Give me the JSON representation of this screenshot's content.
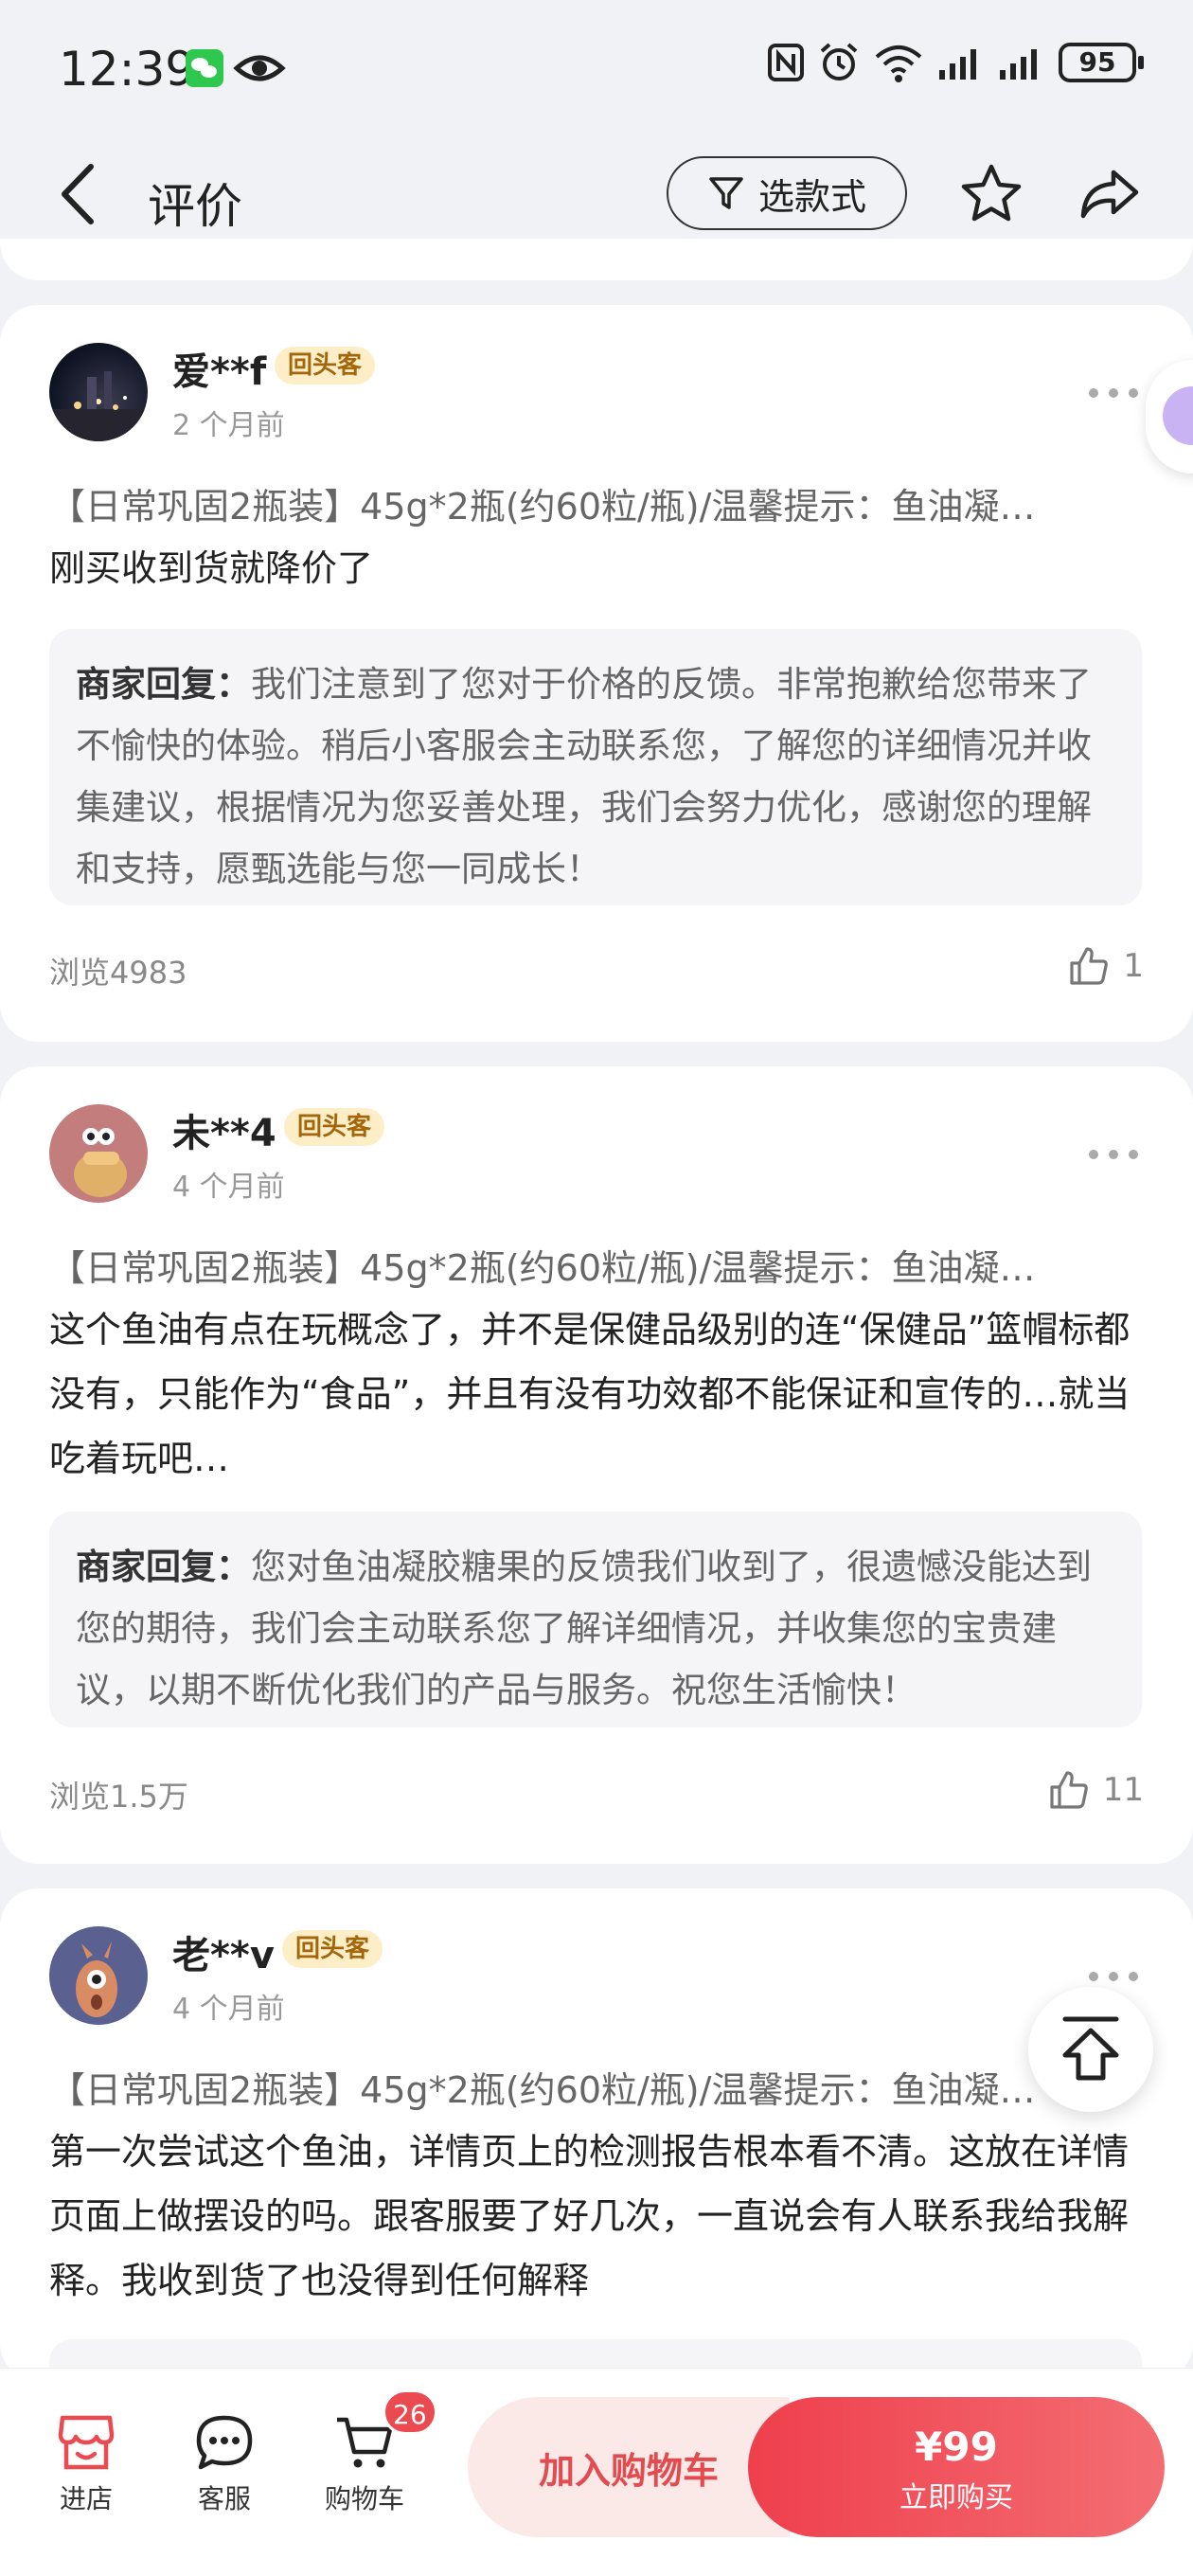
{
  "status_bar": {
    "time": "12:39",
    "battery": "95",
    "icons": [
      "wechat-icon",
      "eye-icon",
      "nfc-icon",
      "alarm-icon",
      "wifi-icon",
      "signal-icon",
      "signal-icon",
      "battery-icon"
    ]
  },
  "nav": {
    "title": "评价",
    "filter_label": "选款式",
    "icons": [
      "back-icon",
      "filter-icon",
      "star-icon",
      "share-icon"
    ]
  },
  "reviews": [
    {
      "username": "爱**f",
      "badge": "回头客",
      "time": "2 个月前",
      "spec": "【日常巩固2瓶装】45g*2瓶(约60粒/瓶)/温馨提示：鱼油凝…",
      "text": "刚买收到货就降价了",
      "reply_label": "商家回复：",
      "reply": "我们注意到了您对于价格的反馈。非常抱歉给您带来了不愉快的体验。稍后小客服会主动联系您，了解您的详细情况并收集建议，根据情况为您妥善处理，我们会努力优化，感谢您的理解和支持，愿甄选能与您一同成长！",
      "views": "浏览4983",
      "likes": "1"
    },
    {
      "username": "未**4",
      "badge": "回头客",
      "time": "4 个月前",
      "spec": "【日常巩固2瓶装】45g*2瓶(约60粒/瓶)/温馨提示：鱼油凝…",
      "text": "这个鱼油有点在玩概念了，并不是保健品级别的连“保健品”篮帽标都没有，只能作为“食品”，并且有没有功效都不能保证和宣传的…就当吃着玩吧…",
      "reply_label": "商家回复：",
      "reply": "您对鱼油凝胶糖果的反馈我们收到了，很遗憾没能达到您的期待，我们会主动联系您了解详细情况，并收集您的宝贵建议，以期不断优化我们的产品与服务。祝您生活愉快！",
      "views": "浏览1.5万",
      "likes": "11"
    },
    {
      "username": "老**v",
      "badge": "回头客",
      "time": "4 个月前",
      "spec": "【日常巩固2瓶装】45g*2瓶(约60粒/瓶)/温馨提示：鱼油凝…",
      "text": "第一次尝试这个鱼油，详情页上的检测报告根本看不清。这放在详情页面上做摆设的吗。跟客服要了好几次，一直说会有人联系我给我解释。我收到货了也没得到任何解释"
    }
  ],
  "bottom_bar": {
    "store": "进店",
    "service": "客服",
    "cart": "购物车",
    "cart_count": "26",
    "add_to_cart": "加入购物车",
    "price": "¥99",
    "buy_now": "立即购买"
  },
  "colors": {
    "accent": "#ec4a51",
    "badge_bg": "#fdeec7",
    "badge_text": "#a3660b",
    "page_bg": "#f1f2f5"
  }
}
